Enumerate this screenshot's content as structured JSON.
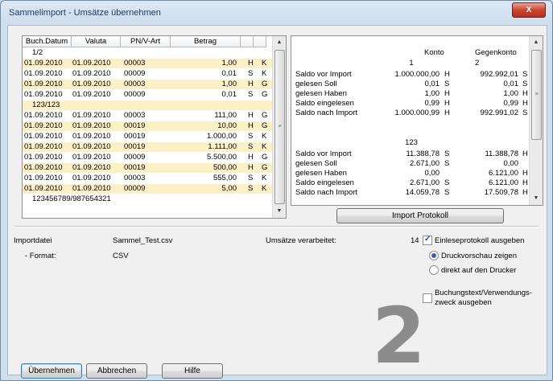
{
  "window": {
    "title": "Sammelimport - Umsätze übernehmen",
    "close_glyph": "X"
  },
  "list": {
    "headers": [
      "Buch.Datum",
      "Valuta",
      "PN/V-Art",
      "Betrag"
    ],
    "rows": [
      {
        "text": "1/2",
        "group": true
      },
      {
        "date": "01.09.2010",
        "valuta": "01.09.2010",
        "pn": "00003",
        "betrag": "1,00",
        "sh": "H",
        "k": "K"
      },
      {
        "date": "01.09.2010",
        "valuta": "01.09.2010",
        "pn": "00009",
        "betrag": "0,01",
        "sh": "S",
        "k": "K"
      },
      {
        "date": "01.09.2010",
        "valuta": "01.09.2010",
        "pn": "00003",
        "betrag": "1,00",
        "sh": "H",
        "k": "G"
      },
      {
        "date": "01.09.2010",
        "valuta": "01.09.2010",
        "pn": "00009",
        "betrag": "0,01",
        "sh": "S",
        "k": "G"
      },
      {
        "text": "123/123",
        "group": true
      },
      {
        "date": "01.09.2010",
        "valuta": "01.09.2010",
        "pn": "00003",
        "betrag": "111,00",
        "sh": "H",
        "k": "G"
      },
      {
        "date": "01.09.2010",
        "valuta": "01.09.2010",
        "pn": "00019",
        "betrag": "10,00",
        "sh": "H",
        "k": "G"
      },
      {
        "date": "01.09.2010",
        "valuta": "01.09.2010",
        "pn": "00019",
        "betrag": "1.000,00",
        "sh": "S",
        "k": "K"
      },
      {
        "date": "01.09.2010",
        "valuta": "01.09.2010",
        "pn": "00019",
        "betrag": "1.111,00",
        "sh": "S",
        "k": "K"
      },
      {
        "date": "01.09.2010",
        "valuta": "01.09.2010",
        "pn": "00009",
        "betrag": "5.500,00",
        "sh": "H",
        "k": "G"
      },
      {
        "date": "01.09.2010",
        "valuta": "01.09.2010",
        "pn": "00019",
        "betrag": "500,00",
        "sh": "H",
        "k": "G"
      },
      {
        "date": "01.09.2010",
        "valuta": "01.09.2010",
        "pn": "00003",
        "betrag": "555,00",
        "sh": "S",
        "k": "K"
      },
      {
        "date": "01.09.2010",
        "valuta": "01.09.2010",
        "pn": "00009",
        "betrag": "5,00",
        "sh": "S",
        "k": "K"
      },
      {
        "text": "123456789/987654321",
        "group": true
      }
    ]
  },
  "summary": {
    "col_konto": "Konto",
    "col_gegenkonto": "Gegenkonto",
    "blocks": [
      {
        "konto": "1",
        "gegenkonto": "2",
        "lines": [
          {
            "label": "Saldo vor Import",
            "k_val": "1.000.000,00",
            "k_sh": "H",
            "g_val": "992.992,01",
            "g_sh": "S"
          },
          {
            "label": "gelesen Soll",
            "k_val": "0,01",
            "k_sh": "S",
            "g_val": "0,01",
            "g_sh": "S"
          },
          {
            "label": "gelesen Haben",
            "k_val": "1,00",
            "k_sh": "H",
            "g_val": "1,00",
            "g_sh": "H"
          },
          {
            "label": "Saldo eingelesen",
            "k_val": "0,99",
            "k_sh": "H",
            "g_val": "0,99",
            "g_sh": "H"
          },
          {
            "label": "Saldo nach Import",
            "k_val": "1.000.000,99",
            "k_sh": "H",
            "g_val": "992.991,02",
            "g_sh": "S"
          }
        ]
      },
      {
        "konto": "123",
        "gegenkonto": "",
        "lines": [
          {
            "label": "Saldo vor Import",
            "k_val": "11.388,78",
            "k_sh": "S",
            "g_val": "11.388,78",
            "g_sh": "H"
          },
          {
            "label": "gelesen Soll",
            "k_val": "2.671,00",
            "k_sh": "S",
            "g_val": "0,00",
            "g_sh": ""
          },
          {
            "label": "gelesen Haben",
            "k_val": "0,00",
            "k_sh": "",
            "g_val": "6.121,00",
            "g_sh": "H"
          },
          {
            "label": "Saldo eingelesen",
            "k_val": "2.671,00",
            "k_sh": "S",
            "g_val": "6.121,00",
            "g_sh": "H"
          },
          {
            "label": "Saldo nach Import",
            "k_val": "14.059,78",
            "k_sh": "S",
            "g_val": "17.509,78",
            "g_sh": "H"
          }
        ]
      }
    ],
    "protokoll_button": "Import Protokoll"
  },
  "info": {
    "importdatei_label": "Importdatei",
    "importdatei_value": "Sammel_Test.csv",
    "format_label": "- Format:",
    "format_value": "CSV",
    "umsaetze_label": "Umsätze verarbeitet:",
    "umsaetze_value": "14"
  },
  "options": {
    "einleseprotokoll": {
      "label": "Einleseprotokoll ausgeben",
      "checked": true
    },
    "druckvorschau": {
      "label": "Druckvorschau zeigen",
      "selected": true
    },
    "drucker": {
      "label": "direkt auf den Drucker",
      "selected": false
    },
    "buchungstext_line1": "Buchungstext/Verwendungs-",
    "buchungstext_line2": "zweck ausgeben",
    "buchungstext_checked": false
  },
  "step_number": "2",
  "buttons": {
    "uebernehmen": "Übernehmen",
    "abbrechen": "Abbrechen",
    "hilfe": "Hilfe"
  },
  "colors": {
    "row_highlight": "#fbf0c6",
    "step_number": "#8c8c8c"
  }
}
